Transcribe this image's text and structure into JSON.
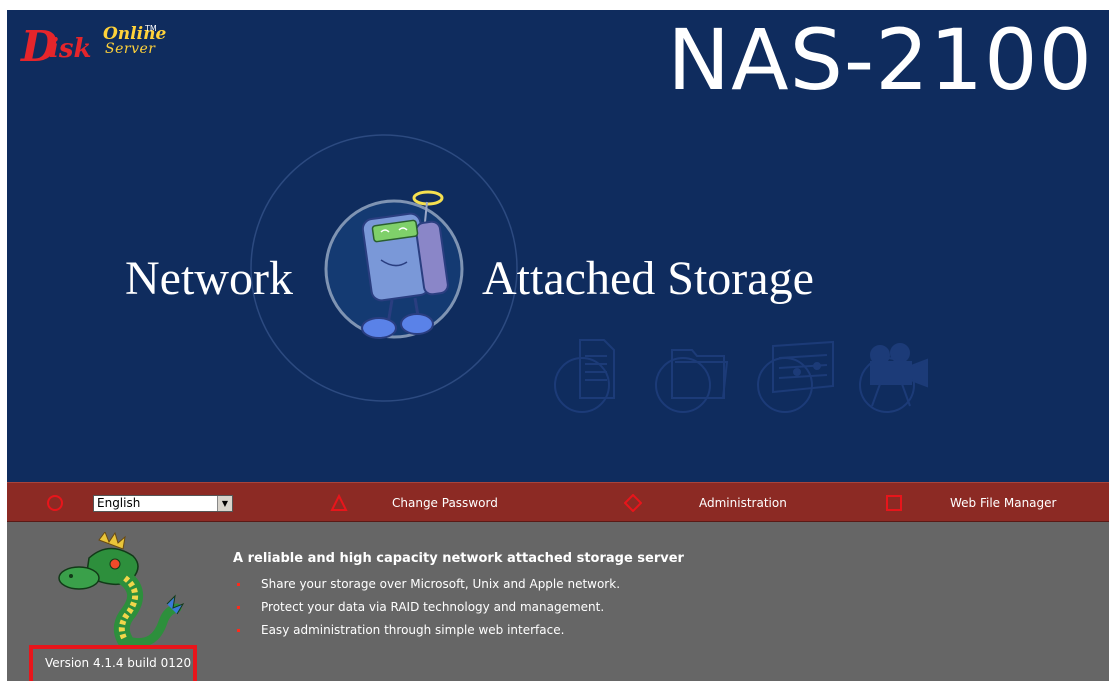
{
  "brand": {
    "logo_d": "D",
    "logo_isk": "isk",
    "logo_online": "Online",
    "logo_tm": "TM",
    "logo_server": "Server"
  },
  "hero": {
    "model": "NAS-2100",
    "tagline_left": "Network",
    "tagline_right": "Attached Storage",
    "icons": [
      "document-icon",
      "folder-icon",
      "music-icon",
      "video-camera-icon"
    ]
  },
  "navbar": {
    "language": {
      "selected": "English"
    },
    "change_password": "Change Password",
    "administration": "Administration",
    "web_file_manager": "Web File Manager",
    "icon_color": "#e8151b"
  },
  "info": {
    "title": "A reliable and high capacity network attached storage server",
    "bullets": [
      "Share your storage over Microsoft, Unix and Apple network.",
      "Protect your data via RAID technology and management.",
      "Easy administration through simple web interface."
    ],
    "version": "Version 4.1.4 build 0120"
  },
  "colors": {
    "hero_bg": "#0f2c5e",
    "navbar_bg": "#8c2a24",
    "info_bg": "#666666",
    "highlight": "#e8151b"
  }
}
